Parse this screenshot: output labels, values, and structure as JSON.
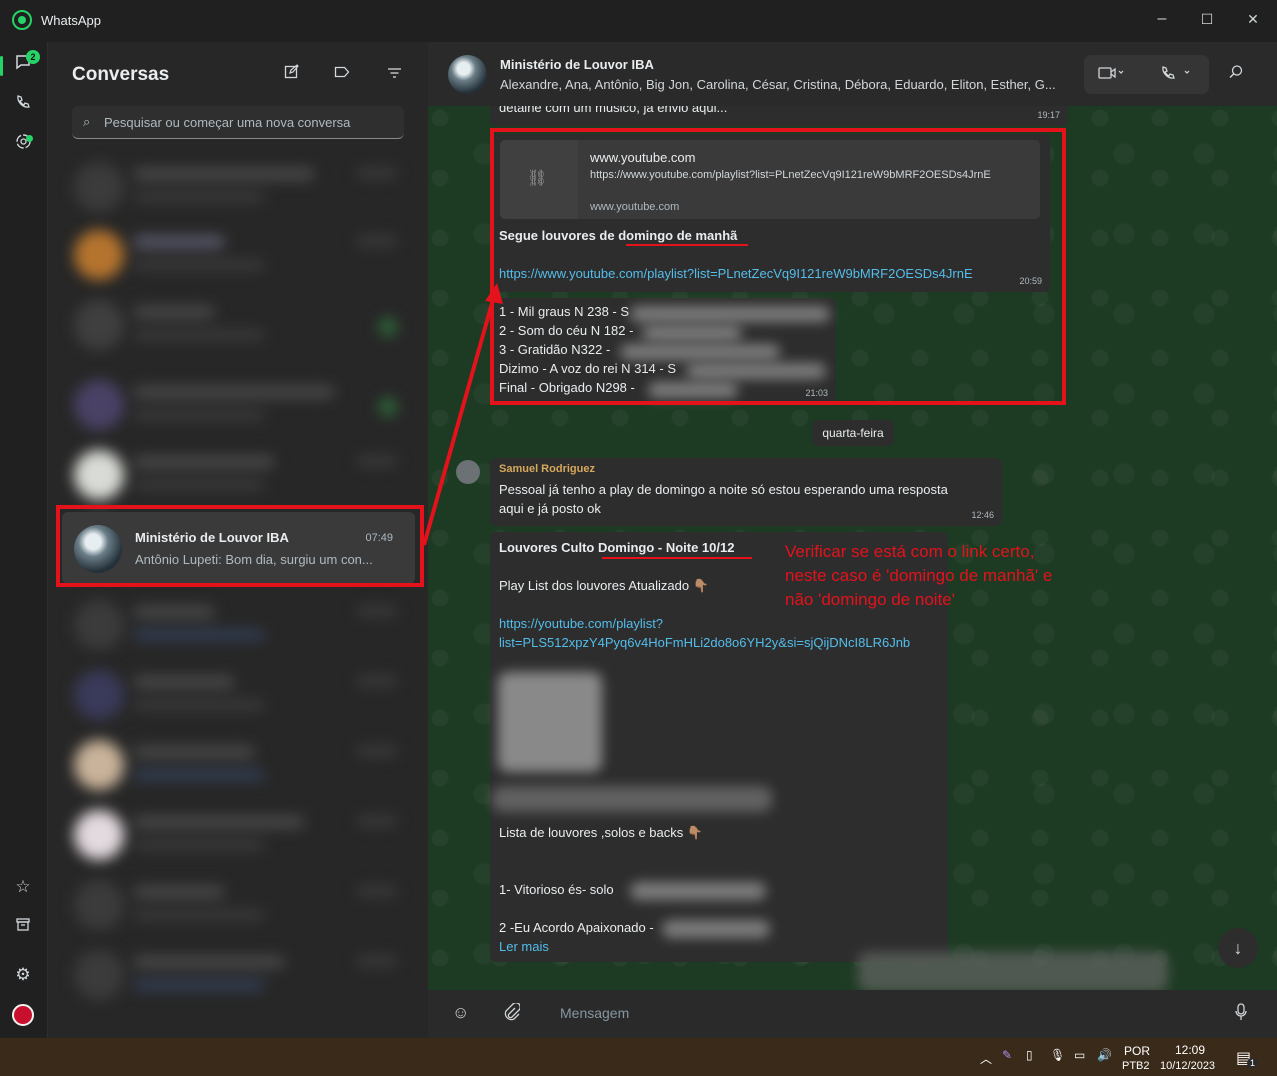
{
  "window": {
    "title": "WhatsApp",
    "minimize": "–",
    "maximize": "☐",
    "close": "✕"
  },
  "rail": {
    "chats_badge": "2"
  },
  "sidebar": {
    "title": "Conversas",
    "search_placeholder": "Pesquisar ou começar uma nova conversa",
    "selected_chat": {
      "name": "Ministério de Louvor IBA",
      "time": "07:49",
      "preview": "Antônio Lupeti: Bom dia, surgiu um con..."
    }
  },
  "chat": {
    "header": {
      "name": "Ministério de Louvor IBA",
      "members": "Alexandre, Ana, Antônio, Big Jon, Carolina, César, Cristina, Débora, Eduardo, Eliton, Esther, G..."
    },
    "msg_top": {
      "text": "detalhe com um músico, já envio aqui...",
      "time": "19:17"
    },
    "msg_link": {
      "preview_domain": "www.youtube.com",
      "preview_url": "https://www.youtube.com/playlist?list=PLnetZecVq9I121reW9bMRF2OESDs4JrnE",
      "preview_footer": "www.youtube.com",
      "caption": "Segue louvores de domingo de manhã",
      "url": "https://www.youtube.com/playlist?list=PLnetZecVq9I121reW9bMRF2OESDs4JrnE",
      "time": "20:59"
    },
    "msg_list": {
      "lines": [
        "1 - Mil graus N 238 - S",
        "2 - Som do céu N 182 -",
        "3 - Gratidão N322 -",
        "Dizimo - A voz do rei N 314 - S",
        "Final - Obrigado N298 -"
      ],
      "time": "21:03"
    },
    "date_divider": "quarta-feira",
    "msg_samuel": {
      "sender": "Samuel Rodriguez",
      "line1": "Pessoal já tenho a play de domingo  a noite só estou esperando uma resposta",
      "line2": "aqui e já posto ok",
      "time": "12:46"
    },
    "msg_culto": {
      "title": "Louvores Culto  Domingo - Noite  10/12",
      "play_list": "Play List dos louvores  Atualizado 👇🏽",
      "url_line1": "https://youtube.com/playlist?",
      "url_line2": "list=PLS512xpzY4Pyq6v4HoFmHLi2do8o6YH2y&si=sjQijDNcI8LR6Jnb",
      "lista": "Lista de louvores ,solos  e backs 👇🏽",
      "item1": "1- Vitorioso és-  solo",
      "item2": "2 -Eu Acordo Apaixonado -",
      "read_more": "Ler mais"
    },
    "input_placeholder": "Mensagem"
  },
  "annotation": {
    "note": "Verificar se está com o link certo, neste caso é 'domingo de manhã' e não 'domingo de noite'"
  },
  "taskbar": {
    "lang1": "POR",
    "lang2": "PTB2",
    "time": "12:09",
    "date": "10/12/2023",
    "notif": "1"
  },
  "colors": {
    "accent": "#25d366",
    "annotation": "#e4121b",
    "link": "#53bdeb"
  }
}
